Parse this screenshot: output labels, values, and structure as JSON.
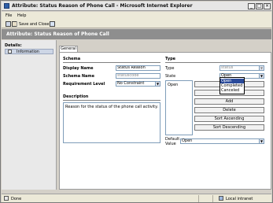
{
  "window": {
    "title": "Attribute: Status Reason of Phone Call - Microsoft Internet Explorer",
    "controls": {
      "minimize": "_",
      "maximize": "□",
      "close": "×"
    }
  },
  "menu": {
    "file": "File",
    "help": "Help"
  },
  "toolbar": {
    "save_close_label": "Save and Close"
  },
  "header": {
    "title": "Attribute: Status Reason of Phone Call"
  },
  "nav": {
    "details": "Details:",
    "information": "Information"
  },
  "tabs": {
    "general": "General"
  },
  "schema": {
    "section_title": "Schema",
    "display_name_label": "Display Name",
    "display_name_value": "Status Reason",
    "schema_name_label": "Schema Name",
    "schema_name_value": "statuscode",
    "requirement_label": "Requirement Level",
    "requirement_value": "No Constraint"
  },
  "description": {
    "section_title": "Description",
    "value": "Reason for the status of the phone call activity."
  },
  "type": {
    "section_title": "Type",
    "type_label": "Type",
    "type_value": "status",
    "state_label": "State",
    "state_value": "Open",
    "state_options": [
      "Open",
      "Completed",
      "Canceled"
    ],
    "list_items": [
      "Open"
    ],
    "buttons": {
      "modify": "Modify",
      "edit": "Edit",
      "add": "Add",
      "delete": "Delete",
      "sort_asc": "Sort Ascending",
      "sort_desc": "Sort Descending"
    },
    "default_value_label_line1": "Default",
    "default_value_label_line2": "Value",
    "default_value": "Open"
  },
  "statusbar": {
    "status": "Done",
    "zone": "Local intranet"
  }
}
